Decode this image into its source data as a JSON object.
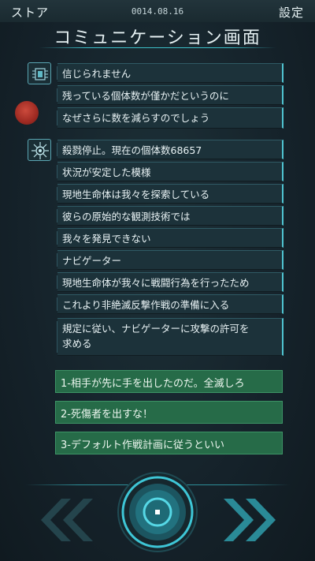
{
  "header": {
    "store_label": "ストア",
    "date": "0014.08.16",
    "settings_label": "設定",
    "title": "コミュニケーション画面"
  },
  "conversation": {
    "alien_messages": [
      "信じられません",
      "残っている個体数が僅かだというのに",
      "なぜさらに数を減らすのでしょう"
    ],
    "navigator_messages": [
      "殺戮停止。現在の個体数68657",
      "状況が安定した模様",
      "現地生命体は我々を探索している",
      "彼らの原始的な観測技術では",
      "我々を発見できない",
      "ナビゲーター",
      "現地生命体が我々に戦闘行為を行ったため",
      "これより非絶滅反撃作戦の準備に入る",
      "規定に従い、ナビゲーターに攻撃の許可を",
      "求める"
    ]
  },
  "choices": [
    "1-相手が先に手を出したのだ。全滅しろ",
    "2-死傷者を出すな！",
    "3-デフォルト作戦計画に従うといい"
  ],
  "icons": {
    "chip": "microchip-icon",
    "alien": "alien-avatar",
    "virus": "virus-icon",
    "prev": "double-chevron-left-icon",
    "next": "double-chevron-right-icon",
    "center": "center-ring-button"
  },
  "colors": {
    "accent": "#4fc3d0",
    "choice_bg": "#266b48",
    "message_bg": "#1c323a",
    "background": "#16242b"
  }
}
